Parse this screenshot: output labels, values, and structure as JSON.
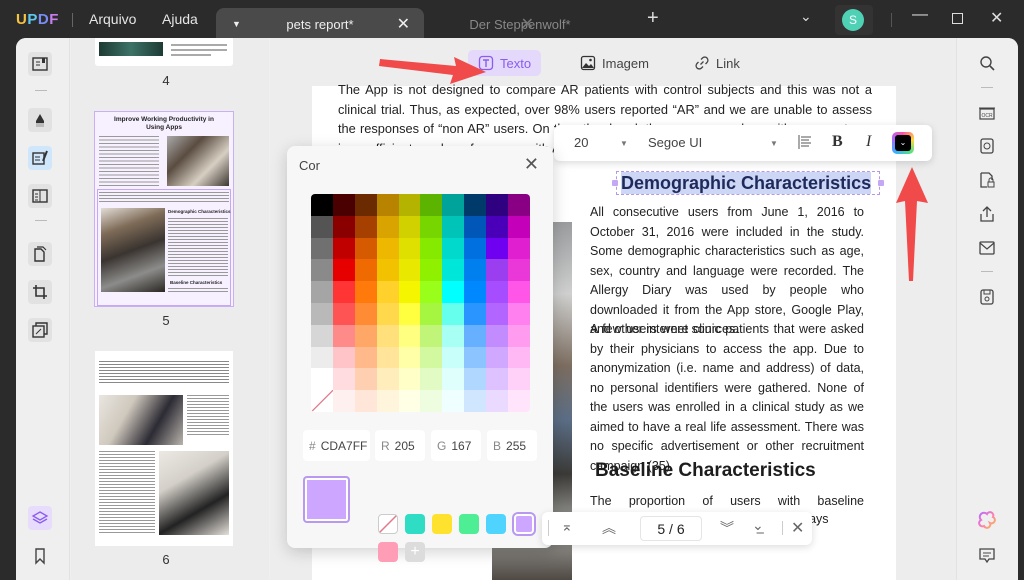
{
  "titlebar": {
    "logo": "UPDF",
    "menu": [
      "Arquivo",
      "Ajuda"
    ],
    "tabs": [
      {
        "label": "pets report*",
        "active": true
      },
      {
        "label": "Der Steppenwolf*",
        "active": false
      }
    ],
    "avatar_initial": "S"
  },
  "edit_tools": {
    "text_label": "Texto",
    "image_label": "Imagem",
    "link_label": "Link"
  },
  "format_bar": {
    "font_size": "20",
    "font_family": "Segoe UI",
    "bold": "B",
    "italic": "I"
  },
  "document": {
    "intro_text": "The App is not designed to compare AR patients with control subjects and this was not a clinical trial. Thus, as expected, over 98% users reported “AR” and we are unable to assess the responses of “non AR” users. On the other hand, there are many days with no symptoms in a sufficient number of persons with AR to allow comparisons between ou",
    "heading1": "Demographic Characteristics",
    "para1": "All consecutive users from June 1, 2016 to October 31, 2016 were included in the study. Some demographic characteristics such as age, sex, country and language were recorded. The Allergy Diary was used by people who downloaded it from the App store, Google Play, and other internet sources.",
    "para2": "A few users were clinic patients that were asked by their physicians to access the app. Due to anonymization (i.e. name and address) of data, no personal identifiers were gathered. None of the users was enrolled in a clinical study as we aimed to have a real life assessment. There was no specific advertisement or other recruitment campaign (35).",
    "heading2": "Baseline Characteristics",
    "para3": "The proportion of users with baseline",
    "para3_tail": "AS days"
  },
  "thumbnails": {
    "pages": [
      "4",
      "5",
      "6"
    ],
    "page5_title": "Improve Working Productivity in Using Apps",
    "page5_heading": "Demographic Characteristics",
    "page5_heading2": "Baseline Characteristics"
  },
  "color_panel": {
    "title": "Cor",
    "hex_label": "#",
    "hex": "CDA7FF",
    "r_label": "R",
    "r": "205",
    "g_label": "G",
    "g": "167",
    "b_label": "B",
    "b": "255",
    "current_color": "#CDA7FF",
    "recent_swatches": [
      "none",
      "#2EDDC4",
      "#FFE22E",
      "#4DEE94",
      "#4FD4FF",
      "#CDA7FF",
      "#FF9DB7"
    ],
    "grid_columns": [
      [
        "#000000",
        "#545454",
        "#707070",
        "#8a8a8a",
        "#a5a5a5",
        "#b9b9b9",
        "#d6d6d6",
        "#ececec",
        "#ffffff",
        "#ffffff"
      ],
      [
        "#4a0000",
        "#8a0000",
        "#c00000",
        "#e60000",
        "#ff3535",
        "#ff5454",
        "#ff8a8a",
        "#ffc4c8",
        "#ffdce0",
        "#fff0f0"
      ],
      [
        "#6b2a00",
        "#a64000",
        "#d65a00",
        "#ef6a00",
        "#ff7a0a",
        "#ff8c34",
        "#ffa767",
        "#ffb98a",
        "#ffcfb2",
        "#ffe6d9"
      ],
      [
        "#b88400",
        "#d9a300",
        "#eeb800",
        "#f2c200",
        "#ffd12a",
        "#ffd84c",
        "#ffe07a",
        "#ffe49a",
        "#ffedbc",
        "#fff5dd"
      ],
      [
        "#b3b300",
        "#d1d100",
        "#e0e000",
        "#e8e800",
        "#f5f500",
        "#ffff40",
        "#ffff80",
        "#ffffa8",
        "#ffffc8",
        "#ffffe6"
      ],
      [
        "#5cb300",
        "#78d600",
        "#86ea00",
        "#8ff000",
        "#99ff1a",
        "#a6f540",
        "#c0f57a",
        "#d2f8a0",
        "#e2fac4",
        "#eefde0"
      ],
      [
        "#00a39a",
        "#00c4b8",
        "#00d9cc",
        "#00e6d9",
        "#00ffff",
        "#66ffee",
        "#a8fff4",
        "#c8fffa",
        "#dffffd",
        "#efffff"
      ],
      [
        "#003a6b",
        "#0057b8",
        "#0070e0",
        "#0080ee",
        "#0088ff",
        "#2a95ff",
        "#66b0ff",
        "#8cc4ff",
        "#b0d7ff",
        "#d0e6ff"
      ],
      [
        "#2f0080",
        "#4a00b8",
        "#7000f0",
        "#9a3ef0",
        "#a64dff",
        "#b366ff",
        "#c28cff",
        "#d0a8ff",
        "#ddc2ff",
        "#eadaff"
      ],
      [
        "#8a0085",
        "#c400b8",
        "#e020d0",
        "#ea38d8",
        "#ff56e8",
        "#ff80ee",
        "#ff9cf0",
        "#ffb8f4",
        "#ffd0f8",
        "#ffe4fb"
      ]
    ]
  },
  "pager": {
    "current": "5",
    "separator": "/",
    "total": "6"
  },
  "colors": {
    "accent": "#8A5CF0",
    "accent_light": "#E4D8FB",
    "annotation_arrow": "#F04A4A",
    "titlebar": "#2B2B2B"
  }
}
